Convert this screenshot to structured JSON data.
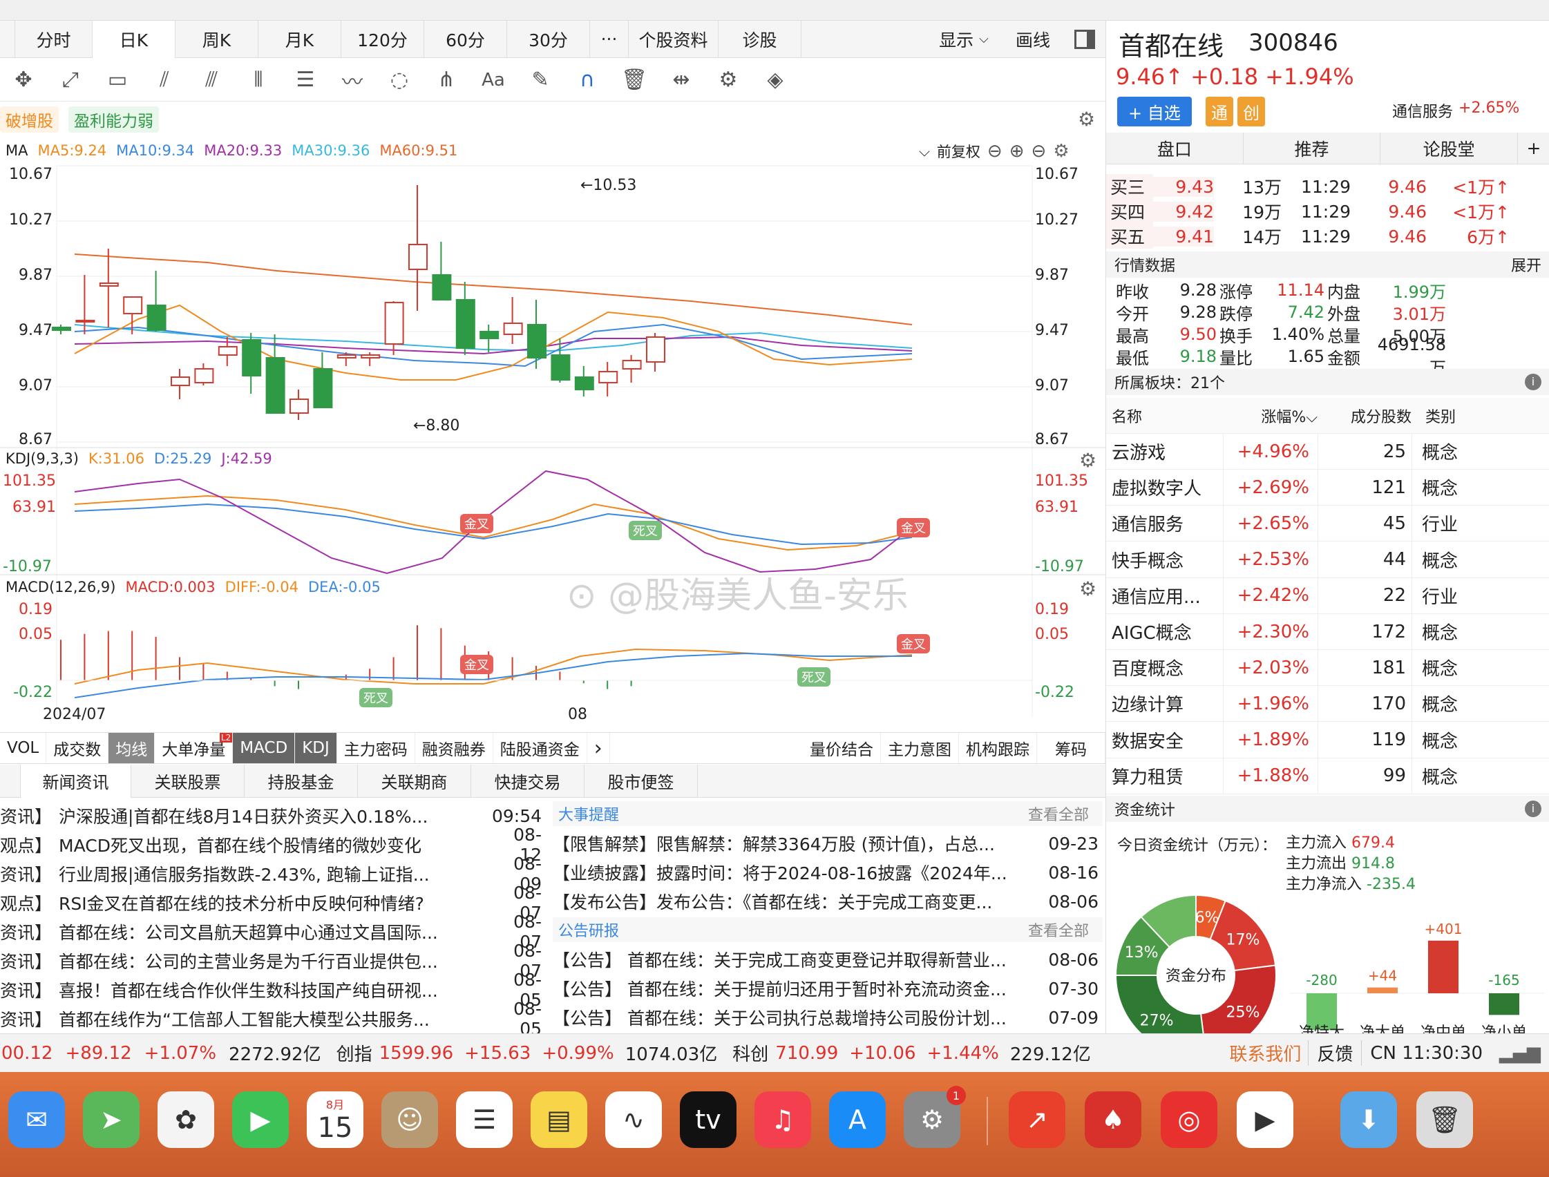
{
  "period_tabs": [
    "分时",
    "日K",
    "周K",
    "月K",
    "120分",
    "60分",
    "30分",
    "···",
    "个股资料",
    "诊股"
  ],
  "active_period": "日K",
  "display_btn": "显示",
  "draw_btn": "画线",
  "tags": [
    "破增股",
    "盈利能力弱"
  ],
  "ma": {
    "label": "MA",
    "ma5": "MA5:9.24",
    "ma10": "MA10:9.34",
    "ma20": "MA20:9.33",
    "ma30": "MA30:9.36",
    "ma60": "MA60:9.51",
    "adjust": "前复权"
  },
  "price_axis": [
    "10.67",
    "10.27",
    "9.87",
    "9.47",
    "9.07",
    "8.67"
  ],
  "kline_annot": {
    "high": "←10.53",
    "low": "←8.80"
  },
  "kdj": {
    "label": "KDJ(9,3,3)",
    "k": "K:31.06",
    "d": "D:25.29",
    "j": "J:42.59",
    "axis": [
      "101.35",
      "63.91",
      "-10.97"
    ]
  },
  "macd": {
    "label": "MACD(12,26,9)",
    "macd": "MACD:0.003",
    "diff": "DIFF:-0.04",
    "dea": "DEA:-0.05",
    "axis": [
      "0.19",
      "0.05",
      "-0.22"
    ]
  },
  "signals": {
    "golden": "金叉",
    "death": "死叉"
  },
  "x_axis": [
    "2024/07",
    "08"
  ],
  "indicator_tabs": [
    "VOL",
    "成交数",
    "均线",
    "大单净量",
    "MACD",
    "KDJ",
    "主力密码",
    "融资融券",
    "陆股通资金",
    "›",
    "量价结合",
    "主力意图",
    "机构跟踪",
    "筹码"
  ],
  "badge": "L2",
  "news_tabs": [
    "新闻资讯",
    "关联股票",
    "持股基金",
    "关联期商",
    "快捷交易",
    "股市便签"
  ],
  "news": [
    {
      "type": "资讯】",
      "title": "沪深股通|首都在线8月14日获外资买入0.18%...",
      "date": "09:54"
    },
    {
      "type": "观点】",
      "title": "MACD死叉出现，首都在线个股情绪的微妙变化",
      "date": "08-12"
    },
    {
      "type": "资讯】",
      "title": "行业周报|通信服务指数跌-2.43%, 跑输上证指...",
      "date": "08-09"
    },
    {
      "type": "观点】",
      "title": "RSI金叉在首都在线的技术分析中反映何种情绪?",
      "date": "08-07"
    },
    {
      "type": "资讯】",
      "title": "首都在线：公司文昌航天超算中心通过文昌国际...",
      "date": "08-07"
    },
    {
      "type": "资讯】",
      "title": "首都在线：公司的主营业务是为千行百业提供包...",
      "date": "08-07"
    },
    {
      "type": "资讯】",
      "title": "喜报！首都在线合作伙伴生数科技国产纯自研视...",
      "date": "08-05"
    },
    {
      "type": "资讯】",
      "title": "首都在线作为“工信部人工智能大模型公共服务...",
      "date": "08-05"
    }
  ],
  "events_header": {
    "title": "大事提醒",
    "more": "查看全部"
  },
  "events": [
    {
      "title": "【限售解禁】限售解禁：解禁3364万股 (预计值)，占总...",
      "date": "09-23"
    },
    {
      "title": "【业绩披露】披露时间：将于2024-08-16披露《2024年...",
      "date": "08-16"
    },
    {
      "title": "【发布公告】发布公告：《首都在线：关于完成工商变更...",
      "date": "08-06"
    }
  ],
  "notice_header": {
    "title": "公告研报",
    "more": "查看全部"
  },
  "notices": [
    {
      "title": "【公告】 首都在线：关于完成工商变更登记并取得新营业...",
      "date": "08-06"
    },
    {
      "title": "【公告】 首都在线：关于提前归还用于暂时补充流动资金...",
      "date": "07-30"
    },
    {
      "title": "【公告】 首都在线：关于公司执行总裁增持公司股份计划...",
      "date": "07-09"
    }
  ],
  "stock": {
    "name": "首都在线",
    "code": "300846",
    "price": "9.46↑",
    "change": "+0.18",
    "pct": "+1.94%",
    "add_btn": "+ 自选",
    "badge1": "通",
    "badge2": "创",
    "sector": "通信服务",
    "sector_pct": "+2.65%"
  },
  "rp_tabs": [
    "盘口",
    "推荐",
    "论股堂",
    "+"
  ],
  "bids": [
    {
      "lbl": "买三",
      "price": "9.43",
      "vol": "13万",
      "time": "11:29",
      "p2": "9.46",
      "v2": "<1万↑"
    },
    {
      "lbl": "买四",
      "price": "9.42",
      "vol": "19万",
      "time": "11:29",
      "p2": "9.46",
      "v2": "<1万↑"
    },
    {
      "lbl": "买五",
      "price": "9.41",
      "vol": "14万",
      "time": "11:29",
      "p2": "9.46",
      "v2": "6万↑"
    }
  ],
  "quote_header": {
    "title": "行情数据",
    "expand": "展开"
  },
  "quote": [
    [
      {
        "k": "昨收",
        "v": "9.28",
        "c": ""
      },
      {
        "k": "涨停",
        "v": "11.14",
        "c": "red"
      },
      {
        "k": "内盘",
        "v": "1.99万",
        "c": "green"
      }
    ],
    [
      {
        "k": "今开",
        "v": "9.28",
        "c": ""
      },
      {
        "k": "跌停",
        "v": "7.42",
        "c": "green"
      },
      {
        "k": "外盘",
        "v": "3.01万",
        "c": "red"
      }
    ],
    [
      {
        "k": "最高",
        "v": "9.50",
        "c": "red"
      },
      {
        "k": "换手",
        "v": "1.40%",
        "c": ""
      },
      {
        "k": "总量",
        "v": "5.00万",
        "c": ""
      }
    ],
    [
      {
        "k": "最低",
        "v": "9.18",
        "c": "green"
      },
      {
        "k": "量比",
        "v": "1.65",
        "c": ""
      },
      {
        "k": "金额",
        "v": "4691.58万",
        "c": ""
      }
    ]
  ],
  "block_header": "所属板块：21个",
  "block_cols": [
    "名称",
    "涨幅%",
    "成分股数",
    "类别"
  ],
  "blocks": [
    {
      "name": "云游戏",
      "pct": "+4.96%",
      "n": "25",
      "cat": "概念"
    },
    {
      "name": "虚拟数字人",
      "pct": "+2.69%",
      "n": "121",
      "cat": "概念"
    },
    {
      "name": "通信服务",
      "pct": "+2.65%",
      "n": "45",
      "cat": "行业"
    },
    {
      "name": "快手概念",
      "pct": "+2.53%",
      "n": "44",
      "cat": "概念"
    },
    {
      "name": "通信应用...",
      "pct": "+2.42%",
      "n": "22",
      "cat": "行业"
    },
    {
      "name": "AIGC概念",
      "pct": "+2.30%",
      "n": "172",
      "cat": "概念"
    },
    {
      "name": "百度概念",
      "pct": "+2.03%",
      "n": "181",
      "cat": "概念"
    },
    {
      "name": "边缘计算",
      "pct": "+1.96%",
      "n": "170",
      "cat": "概念"
    },
    {
      "name": "数据安全",
      "pct": "+1.89%",
      "n": "119",
      "cat": "概念"
    },
    {
      "name": "算力租赁",
      "pct": "+1.88%",
      "n": "99",
      "cat": "概念"
    }
  ],
  "fund_header": "资金统计",
  "fund": {
    "title": "今日资金统计（万元）：",
    "inflow_lbl": "主力流入",
    "inflow": "679.4",
    "outflow_lbl": "主力流出",
    "outflow": "914.8",
    "net_lbl": "主力净流入",
    "net": "-235.4",
    "donut_center": "资金分布",
    "pie": [
      {
        "label": "6%",
        "value": 6,
        "color": "#e85a2a"
      },
      {
        "label": "17%",
        "value": 17,
        "color": "#d93a32"
      },
      {
        "label": "25%",
        "value": 25,
        "color": "#c82a2a"
      },
      {
        "label": "27%",
        "value": 27,
        "color": "#2e7a32"
      },
      {
        "label": "13%",
        "value": 13,
        "color": "#4a9a48"
      },
      {
        "label": "",
        "value": 12,
        "color": "#6cb860"
      }
    ],
    "bars": [
      {
        "name": "净特大",
        "value": -280,
        "label": "-280"
      },
      {
        "name": "净大单",
        "value": 44,
        "label": "+44"
      },
      {
        "name": "净中单",
        "value": 401,
        "label": "+401"
      },
      {
        "name": "净小单",
        "value": -165,
        "label": "-165"
      }
    ]
  },
  "watermark": "@股海美人鱼-安乐",
  "status": {
    "idx1": "00.12",
    "idx1_chg": "+89.12",
    "idx1_pct": "+1.07%",
    "idx1_amt": "2272.92亿",
    "idx2_name": "创指",
    "idx2": "1599.96",
    "idx2_chg": "+15.63",
    "idx2_pct": "+0.99%",
    "idx2_amt": "1074.03亿",
    "idx3_name": "科创",
    "idx3": "710.99",
    "idx3_chg": "+10.06",
    "idx3_pct": "+1.44%",
    "idx3_amt": "229.12亿",
    "contact": "联系我们",
    "feedback": "反馈",
    "clock": "CN 11:30:30"
  },
  "dock": [
    {
      "name": "mail",
      "glyph": "✉",
      "color": "#3a8ef0"
    },
    {
      "name": "maps",
      "glyph": "➤",
      "color": "#5bb85a"
    },
    {
      "name": "photos",
      "glyph": "✿",
      "color": "#f4f4f4"
    },
    {
      "name": "facetime",
      "glyph": "▶",
      "color": "#3cc257"
    },
    {
      "name": "calendar",
      "glyph": "15",
      "color": "#ffffff"
    },
    {
      "name": "contacts",
      "glyph": "☺",
      "color": "#b89a72"
    },
    {
      "name": "reminders",
      "glyph": "☰",
      "color": "#ffffff"
    },
    {
      "name": "notes",
      "glyph": "▤",
      "color": "#f8d548"
    },
    {
      "name": "freeform",
      "glyph": "∿",
      "color": "#ffffff"
    },
    {
      "name": "tv",
      "glyph": "tv",
      "color": "#111111"
    },
    {
      "name": "music",
      "glyph": "♫",
      "color": "#f4404e"
    },
    {
      "name": "appstore",
      "glyph": "A",
      "color": "#1a8cf8"
    },
    {
      "name": "settings",
      "glyph": "⚙",
      "color": "#8a8a8a"
    },
    {
      "name": "app-red1",
      "glyph": "↗",
      "color": "#e8402a"
    },
    {
      "name": "app-red2",
      "glyph": "♠",
      "color": "#d8302a"
    },
    {
      "name": "netease",
      "glyph": "◎",
      "color": "#e8302e"
    },
    {
      "name": "player",
      "glyph": "▶",
      "color": "#ffffff"
    },
    {
      "name": "downloads",
      "glyph": "⬇",
      "color": "#5aa8e8"
    },
    {
      "name": "trash",
      "glyph": "🗑",
      "color": "#dcdcdc"
    }
  ],
  "calendar_month": "8月",
  "settings_badge": "1"
}
